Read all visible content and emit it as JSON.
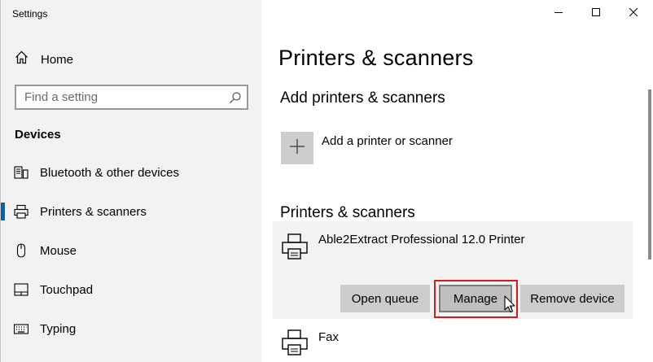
{
  "window": {
    "app_title": "Settings"
  },
  "sidebar": {
    "home_label": "Home",
    "search_placeholder": "Find a setting",
    "section_title": "Devices",
    "items": [
      {
        "label": "Bluetooth & other devices",
        "icon": "bluetooth-devices-icon",
        "active": false
      },
      {
        "label": "Printers & scanners",
        "icon": "printer-icon",
        "active": true
      },
      {
        "label": "Mouse",
        "icon": "mouse-icon",
        "active": false
      },
      {
        "label": "Touchpad",
        "icon": "touchpad-icon",
        "active": false
      },
      {
        "label": "Typing",
        "icon": "keyboard-icon",
        "active": false
      }
    ]
  },
  "main": {
    "page_title": "Printers & scanners",
    "add_section_title": "Add printers & scanners",
    "add_label": "Add a printer or scanner",
    "list_section_title": "Printers & scanners",
    "printers": [
      {
        "name": "Able2Extract Professional 12.0 Printer",
        "expanded": true
      },
      {
        "name": "Fax",
        "expanded": false
      }
    ],
    "buttons": {
      "open_queue": "Open queue",
      "manage": "Manage",
      "remove_device": "Remove device"
    }
  },
  "colors": {
    "accent": "#0063b1",
    "highlight": "#e0141e",
    "sidebar_bg": "#f2f2f2",
    "button_bg": "#cccccc"
  }
}
